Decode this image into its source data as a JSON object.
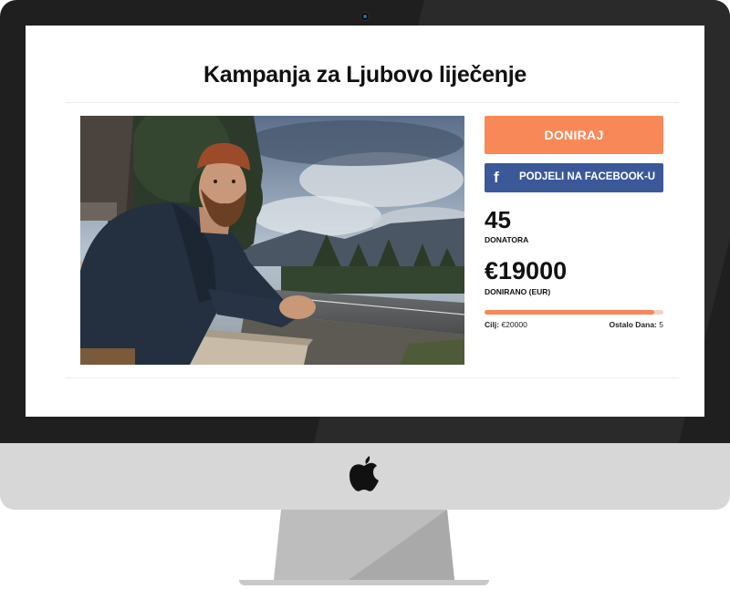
{
  "campaign": {
    "title": "Kampanja za Ljubovo liječenje",
    "donate_label": "DONIRAJ",
    "facebook_label": "PODJELI NA FACEBOOK-U",
    "facebook_icon": "facebook-icon",
    "donors_count": "45",
    "donors_label": "DONATORA",
    "donated_amount": "€19000",
    "donated_label": "DONIRANO (EUR)",
    "goal_label": "Cilj:",
    "goal_value": "€20000",
    "days_left_label": "Ostalo Dana:",
    "days_left_value": "5",
    "progress_fraction": 0.95
  },
  "colors": {
    "accent": "#f98859",
    "facebook": "#3b5998",
    "bezel": "#1f1f1f",
    "chin": "#d7d7d7"
  },
  "device": {
    "logo": "apple-logo-icon"
  }
}
